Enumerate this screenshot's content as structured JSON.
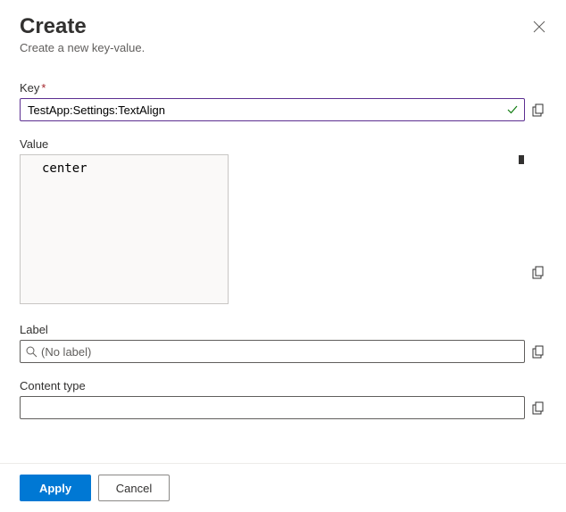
{
  "header": {
    "title": "Create",
    "subtitle": "Create a new key-value."
  },
  "fields": {
    "key": {
      "label": "Key",
      "value": "TestApp:Settings:TextAlign",
      "required_marker": "*"
    },
    "value": {
      "label": "Value",
      "value": "center"
    },
    "label_field": {
      "label": "Label",
      "placeholder": "(No label)",
      "value": ""
    },
    "content_type": {
      "label": "Content type",
      "value": ""
    }
  },
  "footer": {
    "apply": "Apply",
    "cancel": "Cancel"
  }
}
